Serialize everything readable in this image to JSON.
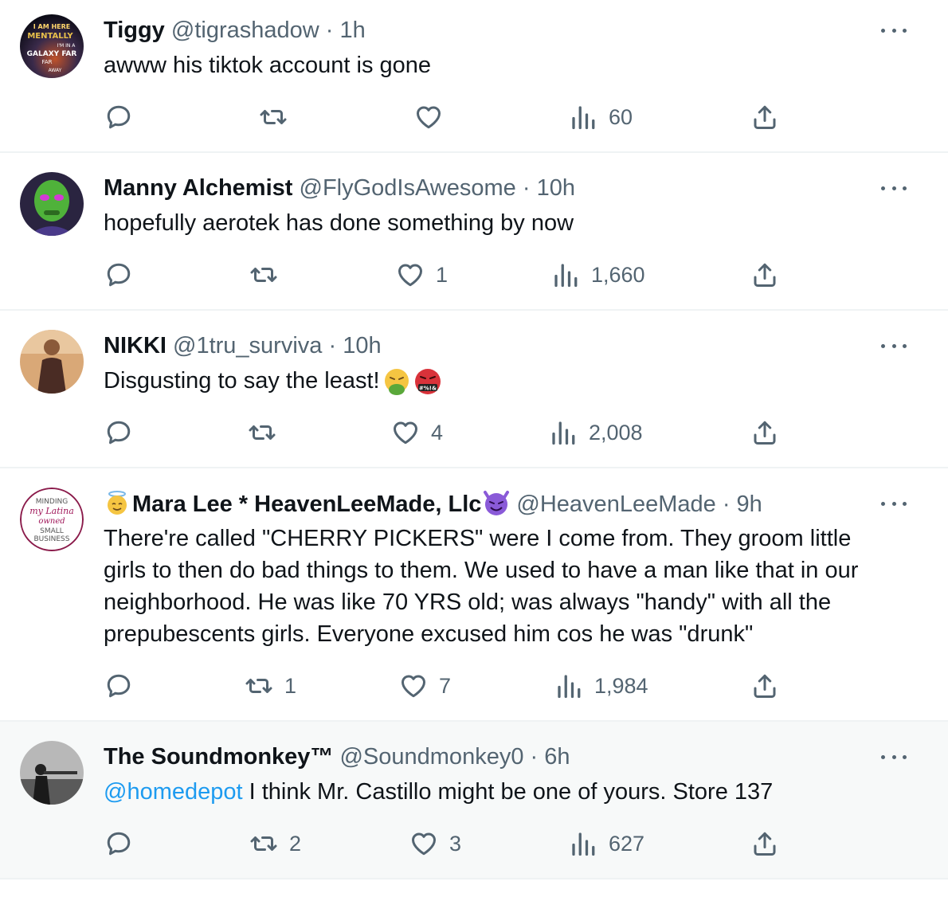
{
  "tweets": [
    {
      "name": "Tiggy",
      "handle": "@tigrashadow",
      "sep": "·",
      "time": "1h",
      "text": "awww his tiktok account is gone",
      "replies": "",
      "retweets": "",
      "likes": "",
      "views": "60",
      "avatar_text": [
        "I AM HERE",
        "MENTALLY",
        "I'M IN A",
        "GALAXY FAR",
        "FAR",
        "AWAY"
      ]
    },
    {
      "name": "Manny Alchemist",
      "handle": "@FlyGodIsAwesome",
      "sep": "·",
      "time": "10h",
      "text": "hopefully aerotek has done something by now",
      "replies": "",
      "retweets": "",
      "likes": "1",
      "views": "1,660"
    },
    {
      "name": "NIKKI",
      "handle": "@1tru_surviva",
      "sep": "·",
      "time": "10h",
      "text": "Disgusting to say the least!",
      "replies": "",
      "retweets": "",
      "likes": "4",
      "views": "2,008",
      "emoji_symbols": "#%!&"
    },
    {
      "name": "Mara Lee * HeavenLeeMade, Llc",
      "handle": "@HeavenLeeMade",
      "sep": "·",
      "time": "9h",
      "text_lines": [
        "There're called \"CHERRY PICKERS\" were I come from.  They groom little",
        "girls to then do bad things to them.  We used to have a man like that in our",
        "neighborhood.  He was like 70 YRS old;  was always \"handy\" with all the",
        "prepubescents girls. Everyone excused him cos he was \"drunk\""
      ],
      "replies": "",
      "retweets": "1",
      "likes": "7",
      "views": "1,984",
      "avatar_text": [
        "MINDING",
        "my Latina",
        "owned",
        "SMALL",
        "BUSINESS"
      ]
    },
    {
      "name": "The Soundmonkey™",
      "handle": "@Soundmonkey0",
      "sep": "·",
      "time": "6h",
      "mention": "@homedepot",
      "text": " I think Mr. Castillo might be one of yours. Store 137",
      "replies": "",
      "retweets": "2",
      "likes": "3",
      "views": "627"
    }
  ],
  "colors": {
    "text": "#0f1419",
    "secondary": "#536471",
    "link": "#1d9bf0",
    "divider": "#eff3f4",
    "highlight_bg": "#f7f9f9"
  },
  "icons": [
    "reply-icon",
    "retweet-icon",
    "like-icon",
    "views-icon",
    "share-icon",
    "more-icon"
  ]
}
